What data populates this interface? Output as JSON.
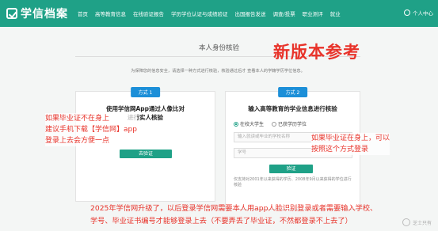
{
  "header": {
    "logo_text": "学信档案",
    "nav": [
      "首页",
      "高等教育信息",
      "在线验证报告",
      "学历学位认证与成绩验证",
      "出国报告发送",
      "调查/投票",
      "职业测评",
      "就业"
    ],
    "user_label": "个人中心"
  },
  "page": {
    "title": "本人身份核验",
    "notice": "为保障您的信息安全，请选择一种方式进行核验，核验通过后才 查看本人的学籍学历学位信息。"
  },
  "method1": {
    "badge": "方式 1",
    "title_line1": "使用学信网App通过人像比对",
    "title_line2": "进行实人核验",
    "button": "去验证"
  },
  "method2": {
    "badge": "方式 2",
    "title": "输入高等教育的学业信息进行核验",
    "radio_current": "在校大学生",
    "radio_graduated": "已获学历学位",
    "field_1_placeholder": "输入就读或毕业的学校名称",
    "field_2_placeholder": "学号",
    "button": "验证",
    "hint": "仅支持对2001年以来获得的学历、2008年9月以来获得的学位进行核验"
  },
  "annotations": {
    "stamp": "新版本参考",
    "left_line1": "如果毕业证不在身上",
    "left_line2": "建议手机下载【学信网】app",
    "left_line3": "登录上去会方便一点",
    "right_line1": "如果毕业证在身上，可以",
    "right_line2": "按照这个方式登录",
    "bottom_line1": "2025年学信网升级了，以后登录学信网需要本人用app人脸识别登录或者需要输入学校、",
    "bottom_line2": "学号、毕业证书编号才能够登录上去（不要弄丢了毕业证，不然都登录不上去了）"
  },
  "watermark": "芝士只有",
  "colors": {
    "brand": "#1fa187",
    "badge": "#1c8fd8",
    "annotation": "#e8332a"
  }
}
